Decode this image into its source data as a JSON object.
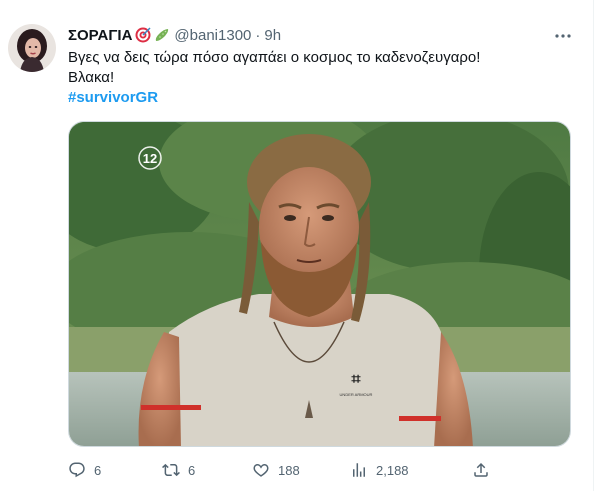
{
  "tweet": {
    "display_name": "ΣΟΡΑΓΙΑ",
    "handle": "@bani1300",
    "separator": "·",
    "time": "9h",
    "text_line1": "Βγες να δεις τώρα πόσο αγαπάει ο κοσμος το καδενοζευγαρο!",
    "text_line2": "Βλακα!",
    "hashtag": "#survivorGR",
    "emojis": [
      "direct-hit-emoji",
      "cucumber-emoji"
    ],
    "media": {
      "overlay_badge": "12",
      "shirt_logo": "UNDER ARMOUR"
    }
  },
  "actions": {
    "reply_count": "6",
    "retweet_count": "6",
    "like_count": "188",
    "views_count": "2,188"
  },
  "colors": {
    "accent": "#1d9bf0",
    "secondary_text": "#536471",
    "primary_text": "#0f1419",
    "border": "#cfd9de"
  }
}
